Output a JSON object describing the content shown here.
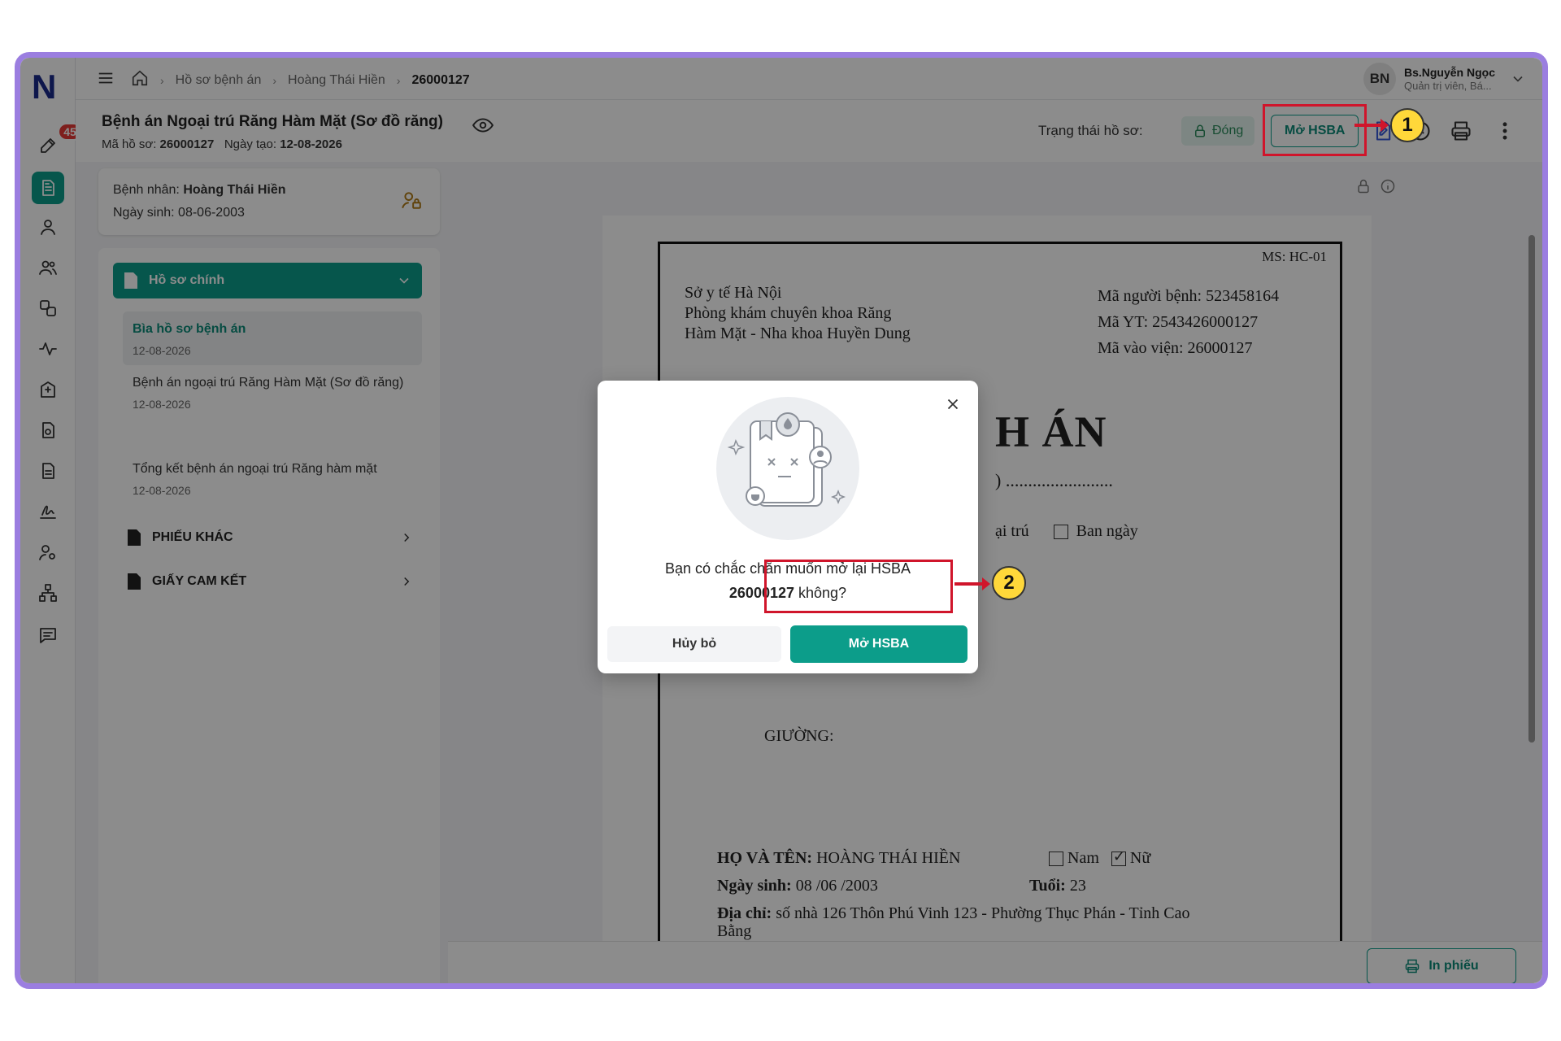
{
  "app": {
    "logo": "N",
    "notification_count": "45"
  },
  "breadcrumb": {
    "items": [
      "Hồ sơ bệnh án",
      "Hoàng Thái Hiền",
      "26000127"
    ]
  },
  "user": {
    "initials": "BN",
    "name": "Bs.Nguyễn Ngọc",
    "role": "Quản trị viên, Bá..."
  },
  "header": {
    "title": "Bệnh án Ngoại trú Răng Hàm Mặt (Sơ đồ răng)",
    "record_label": "Mã hồ sơ:",
    "record_code": "26000127",
    "created_label": "Ngày tạo:",
    "created_date": "12-08-2026",
    "status_label": "Trạng thái hồ sơ:",
    "status_value": "Đóng",
    "open_button": "Mở HSBA"
  },
  "patient": {
    "name_label": "Bệnh nhân:",
    "name": "Hoàng Thái Hiền",
    "dob_label": "Ngày sinh:",
    "dob": "08-06-2003"
  },
  "nav": {
    "main_section": "Hồ sơ chính",
    "items": [
      {
        "title": "Bìa hồ sơ bệnh án",
        "date": "12-08-2026"
      },
      {
        "title": "Bệnh án ngoại trú Răng Hàm Mặt (Sơ đồ răng)",
        "date": "12-08-2026"
      },
      {
        "title": "Tổng kết bệnh án ngoại trú Răng hàm mặt",
        "date": "12-08-2026"
      }
    ],
    "other_sections": [
      "PHIẾU KHÁC",
      "GIẤY CAM KẾT"
    ]
  },
  "document": {
    "ms": "MS: HC-01",
    "org_line1": "Sở y tế Hà Nội",
    "org_line2": "Phòng khám chuyên khoa Răng",
    "org_line3": "Hàm Mặt - Nha khoa Huyền Dung",
    "patient_code": "Mã người bệnh: 523458164",
    "yt_code": "Mã YT: 2543426000127",
    "admission_code": "Mã vào viện: 26000127",
    "title_fragment": "H ÁN",
    "dots_fragment": ") ........................",
    "check_fragment": "ại trú",
    "check_daytime": "Ban ngày",
    "bed_label": "GIƯỜNG:",
    "name_label": "HỌ VÀ TÊN:",
    "name_value": "HOÀNG THÁI HIỀN",
    "male": "Nam",
    "female": "Nữ",
    "dob_label": "Ngày sinh:",
    "dob_value": "08 /06 /2003",
    "age_label": "Tuổi:",
    "age_value": "23",
    "address_label": "Địa chỉ:",
    "address_value": "số nhà 126 Thôn Phú Vinh 123 - Phường Thục Phán - Tỉnh Cao",
    "address_value2": "Bằng"
  },
  "footer": {
    "print_button": "In phiếu"
  },
  "modal": {
    "question_line1": "Bạn có chắc chắn muốn mở lại HSBA",
    "record_code": "26000127",
    "question_end": "không?",
    "cancel": "Hủy bỏ",
    "confirm": "Mở HSBA"
  },
  "callouts": [
    "1",
    "2"
  ],
  "colors": {
    "primary": "#0c9d8a",
    "highlight": "#d0152b",
    "frame": "#9b7ee0",
    "callout": "#ffd83a"
  }
}
